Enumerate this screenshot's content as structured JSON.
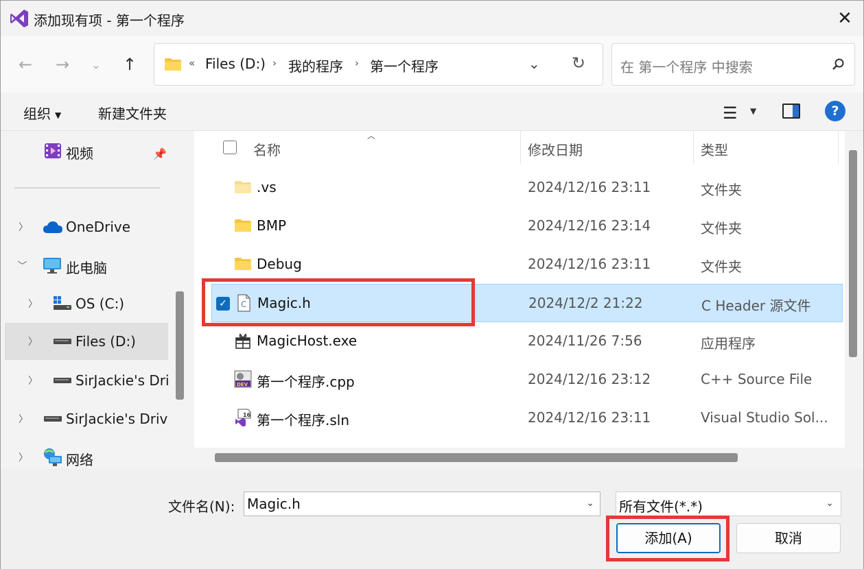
{
  "window": {
    "title": "添加现有项 - 第一个程序"
  },
  "address": {
    "crumbs": [
      "Files (D:)",
      "我的程序",
      "第一个程序"
    ],
    "overflow": "«",
    "separator": "›"
  },
  "search": {
    "placeholder": "在 第一个程序 中搜索"
  },
  "toolbar": {
    "organize": "组织",
    "new_folder": "新建文件夹",
    "help": "?"
  },
  "sidebar": {
    "items": [
      {
        "label": "视频",
        "icon": "video-icon"
      },
      {
        "label": "OneDrive",
        "icon": "cloud-icon"
      },
      {
        "label": "此电脑",
        "icon": "computer-icon"
      },
      {
        "label": "OS (C:)",
        "icon": "drive-c-icon"
      },
      {
        "label": "Files (D:)",
        "icon": "drive-icon",
        "selected": true
      },
      {
        "label": "SirJackie's Dri",
        "icon": "drive-icon"
      },
      {
        "label": "SirJackie's Drive",
        "icon": "drive-icon"
      },
      {
        "label": "网络",
        "icon": "network-icon"
      }
    ]
  },
  "columns": {
    "name": "名称",
    "modified": "修改日期",
    "type": "类型"
  },
  "files": [
    {
      "name": ".vs",
      "date": "2024/12/16 23:11",
      "type": "文件夹",
      "icon": "folder-icon"
    },
    {
      "name": "BMP",
      "date": "2024/12/16 23:14",
      "type": "文件夹",
      "icon": "folder-icon"
    },
    {
      "name": "Debug",
      "date": "2024/12/16 23:11",
      "type": "文件夹",
      "icon": "folder-icon"
    },
    {
      "name": "Magic.h",
      "date": "2024/12/2 21:22",
      "type": "C Header 源文件",
      "icon": "c-header-icon",
      "selected": true
    },
    {
      "name": "MagicHost.exe",
      "date": "2024/11/26 7:56",
      "type": "应用程序",
      "icon": "exe-icon"
    },
    {
      "name": "第一个程序.cpp",
      "date": "2024/12/16 23:12",
      "type": "C++ Source File",
      "icon": "dev-cpp-icon"
    },
    {
      "name": "第一个程序.sln",
      "date": "2024/12/16 23:11",
      "type": "Visual Studio Sol...",
      "icon": "vs-sln-icon"
    }
  ],
  "bottom": {
    "filename_label": "文件名(N):",
    "filename_value": "Magic.h",
    "filter_value": "所有文件(*.*)",
    "add_button": "添加(A)",
    "cancel_button": "取消"
  },
  "colors": {
    "selection": "#cce8ff",
    "accent": "#0f6cbd",
    "highlight": "#e53935"
  }
}
